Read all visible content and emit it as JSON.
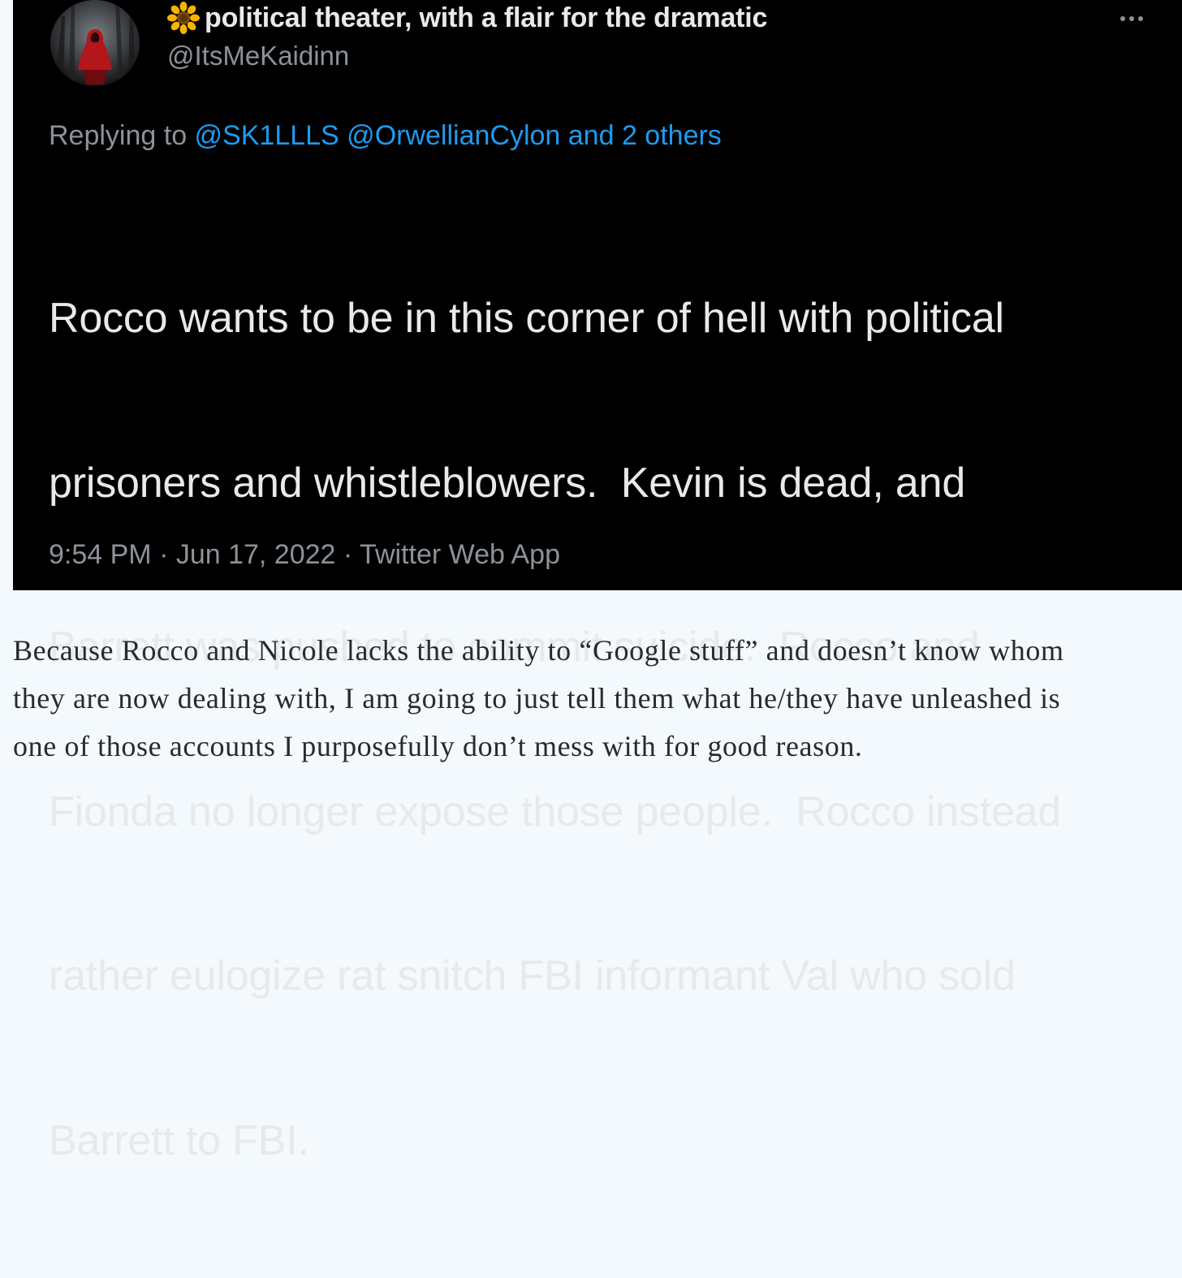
{
  "tweet": {
    "display_name": "political theater, with a flair for the dramatic",
    "handle": "@ItsMeKaidinn",
    "name_emoji_icon": "sunflower-icon",
    "avatar_icon": "red-hooded-figure-avatar",
    "more_icon": "more-horizontal-icon",
    "replying_prefix": "Replying to ",
    "replying_mentions": "@SK1LLLS @OrwellianCylon and 2 others",
    "text_lines": [
      "Rocco wants to be in this corner of hell with political",
      "prisoners and whistleblowers.  Kevin is dead, and",
      "Barrett was pushed to commit suicide.  Rocco and",
      "Fionda no longer expose those people.  Rocco instead",
      "rather eulogize rat snitch FBI informant Val who sold",
      "Barrett to FBI."
    ],
    "timestamp": "9:54 PM · Jun 17, 2022 · Twitter Web App"
  },
  "article": {
    "paragraph_lines": [
      "Because Rocco and Nicole lacks the ability to “Google stuff” and doesn’t know whom",
      "they are now dealing with, I am going to just tell them what he/they have unleashed is",
      "one of those accounts I purposefully don’t mess with for good reason."
    ]
  },
  "colors": {
    "tweet_background": "#000000",
    "tweet_text": "#e7e9ea",
    "secondary_text": "#8b9299",
    "mention_blue": "#1d9bf0",
    "page_background": "#f3f9fc",
    "article_text": "#2a2a2a"
  }
}
